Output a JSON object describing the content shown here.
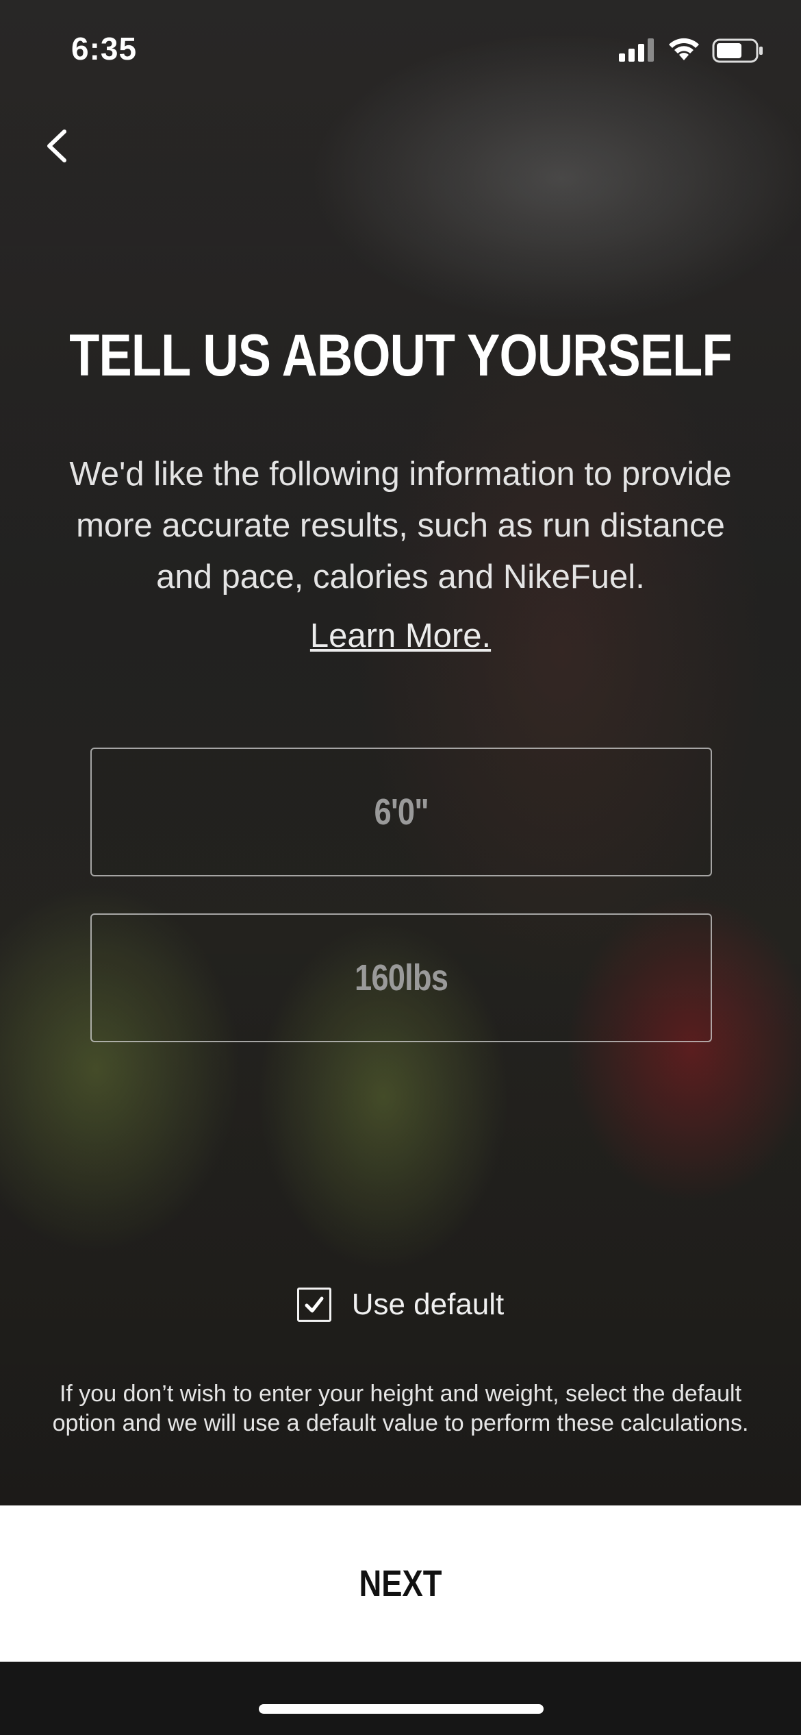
{
  "status_bar": {
    "time": "6:35",
    "icons": [
      "signal-icon",
      "wifi-icon",
      "battery-icon"
    ]
  },
  "navigation": {
    "back_icon": "chevron-left-icon"
  },
  "header": {
    "title": "TELL US ABOUT YOURSELF",
    "description": "We'd like the following information to provide more accurate results, such as run distance and pace, calories and NikeFuel.",
    "learn_more": "Learn More."
  },
  "form": {
    "height_value": "6'0\"",
    "weight_value": "160lbs",
    "use_default_label": "Use default",
    "use_default_checked": true
  },
  "footnote": "If you don’t wish to enter your height and weight, select the default option and we will use a default value to perform these calculations.",
  "actions": {
    "next_label": "NEXT"
  }
}
